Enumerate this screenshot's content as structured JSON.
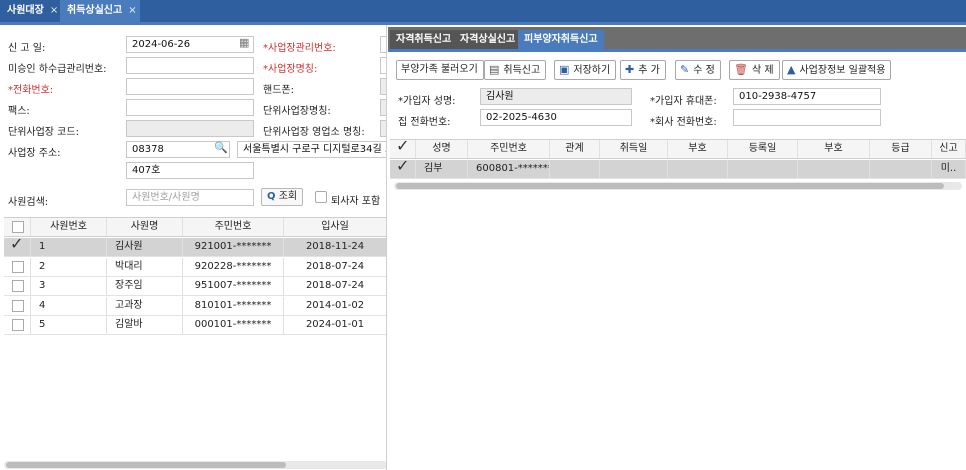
{
  "top_tabs": [
    {
      "label": "사원대장",
      "close": "×"
    },
    {
      "label": "취득상실신고",
      "close": "×"
    }
  ],
  "left_form": {
    "report_date_label": "신 고 일:",
    "report_date_value": "2024-06-26",
    "unapproved_label": "미승인 하수급관리번호:",
    "phone_label": "*전화번호:",
    "fax_label": "팩스:",
    "unit_code_label": "단위사업장 코드:",
    "address_label": "사업장 주소:",
    "zip_value": "08378",
    "address1_value": "서울특별시 구로구 디지털로34길 55 (",
    "address2_value": "407호",
    "biz_mgmt_no_label": "*사업장관리번호:",
    "biz_name_label": "*사업장명칭:",
    "mobile_label": "핸드폰:",
    "unit_name_label": "단위사업장명칭:",
    "unit_office_label": "단위사업장 영업소 명칭:",
    "search_label": "사원검색:",
    "search_placeholder": "사원번호/사원명",
    "search_button": "조회",
    "include_retired_label": "퇴사자 포함"
  },
  "employee_table": {
    "columns": [
      "사원번호",
      "사원명",
      "주민번호",
      "입사일"
    ],
    "rows": [
      {
        "no": "1",
        "name": "김사원",
        "rrn": "921001-*******",
        "date": "2018-11-24",
        "checked": true
      },
      {
        "no": "2",
        "name": "박대리",
        "rrn": "920228-*******",
        "date": "2018-07-24",
        "checked": false
      },
      {
        "no": "3",
        "name": "장주임",
        "rrn": "951007-*******",
        "date": "2018-07-24",
        "checked": false
      },
      {
        "no": "4",
        "name": "고과장",
        "rrn": "810101-*******",
        "date": "2014-01-02",
        "checked": false
      },
      {
        "no": "5",
        "name": "김알바",
        "rrn": "000101-*******",
        "date": "2024-01-01",
        "checked": false
      }
    ]
  },
  "right_tabs": [
    "자격취득신고",
    "자격상실신고",
    "피부양자취득신고"
  ],
  "toolbar": {
    "load_dependents": "부양가족 불러오기",
    "cancel_acquire": "취득신고",
    "save": "저장하기",
    "add": "추 가",
    "edit": "수 정",
    "delete": "삭 제",
    "apply_biz": "사업장정보 일괄적용"
  },
  "subscriber": {
    "name_label": "*가입자 성명:",
    "name_value": "김사원",
    "mobile_label": "*가입자 휴대폰:",
    "mobile_value": "010-2938-4757",
    "home_phone_label": "집 전화번호:",
    "home_phone_value": "02-2025-4630",
    "work_phone_label": "*회사 전화번호:"
  },
  "dependent_table": {
    "columns": [
      "성명",
      "주민번호",
      "관계",
      "취득일",
      "부호",
      "등록일",
      "부호",
      "등급",
      "신고"
    ],
    "rows": [
      {
        "name": "김부",
        "rrn": "600801-*******",
        "last": "미..",
        "checked": true
      }
    ]
  },
  "colors": {
    "topbar": "#2f5f9e",
    "active_tab": "#4a7bbd",
    "right_tab_bar": "#6e6e6e"
  }
}
